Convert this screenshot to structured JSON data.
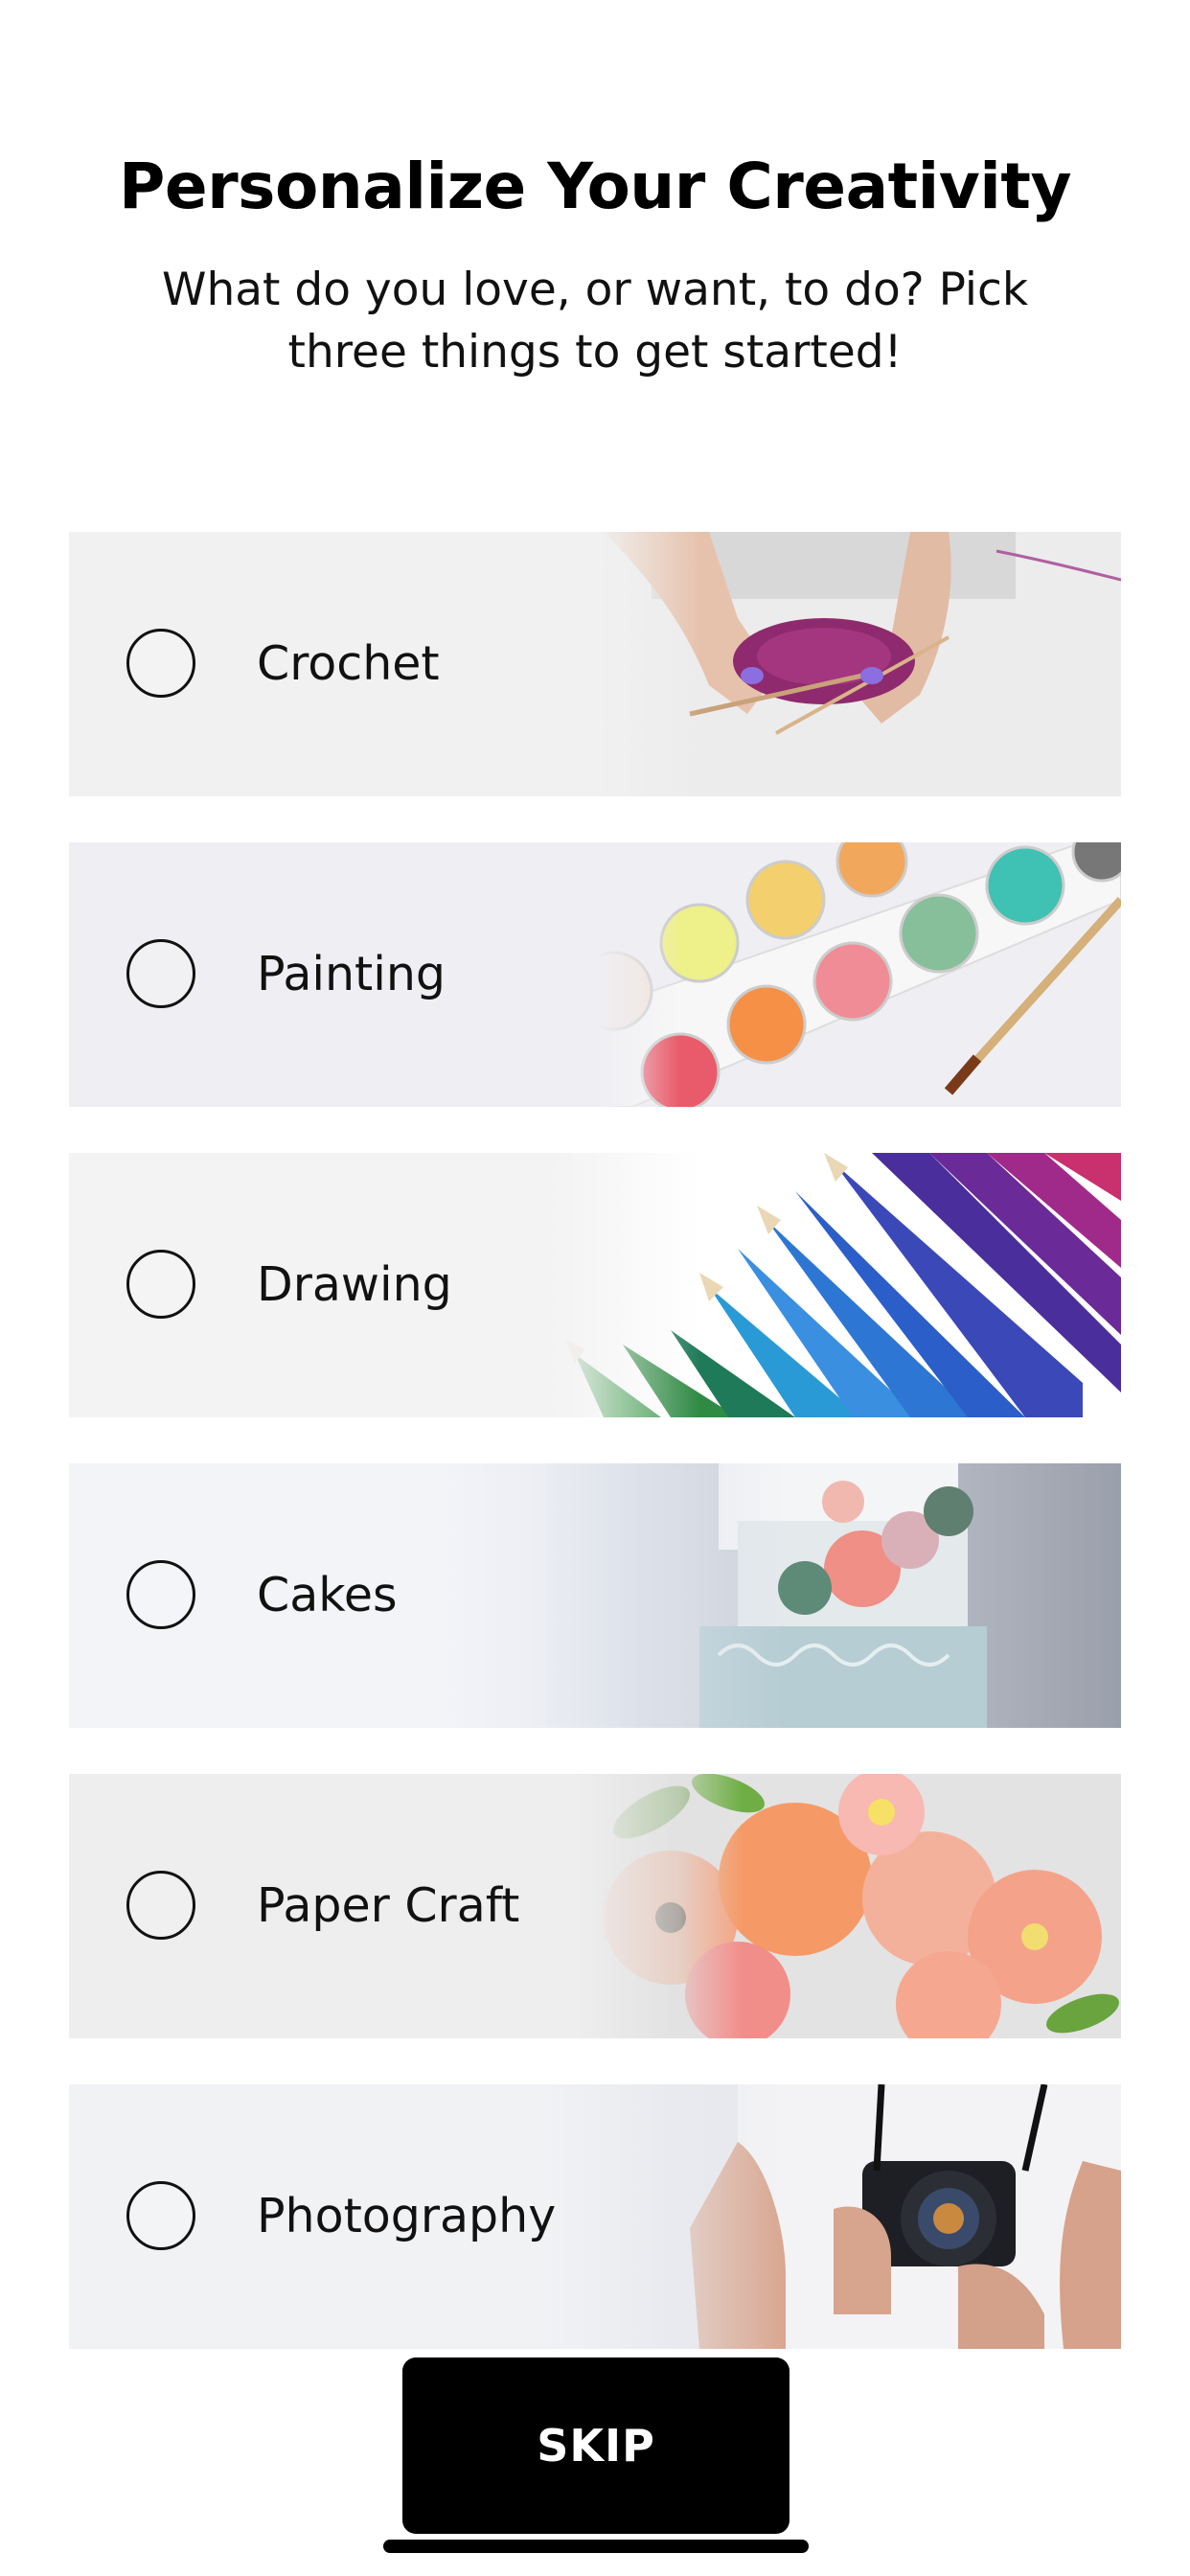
{
  "header": {
    "title": "Personalize Your Creativity",
    "subtitle": "What do you love, or want, to do? Pick three things to get started!"
  },
  "options": [
    {
      "label": "Crochet",
      "selected": false,
      "image": "hands-crocheting-purple-yarn"
    },
    {
      "label": "Painting",
      "selected": false,
      "image": "watercolor-paint-palette-brush"
    },
    {
      "label": "Drawing",
      "selected": false,
      "image": "colored-pencils"
    },
    {
      "label": "Cakes",
      "selected": false,
      "image": "tiered-cake-sugar-flowers"
    },
    {
      "label": "Paper Craft",
      "selected": false,
      "image": "paper-flowers-bouquet"
    },
    {
      "label": "Photography",
      "selected": false,
      "image": "person-holding-camera"
    }
  ],
  "footer": {
    "skip_label": "SKIP"
  },
  "colors": {
    "accent": "#000000",
    "background": "#ffffff",
    "text": "#111111"
  }
}
